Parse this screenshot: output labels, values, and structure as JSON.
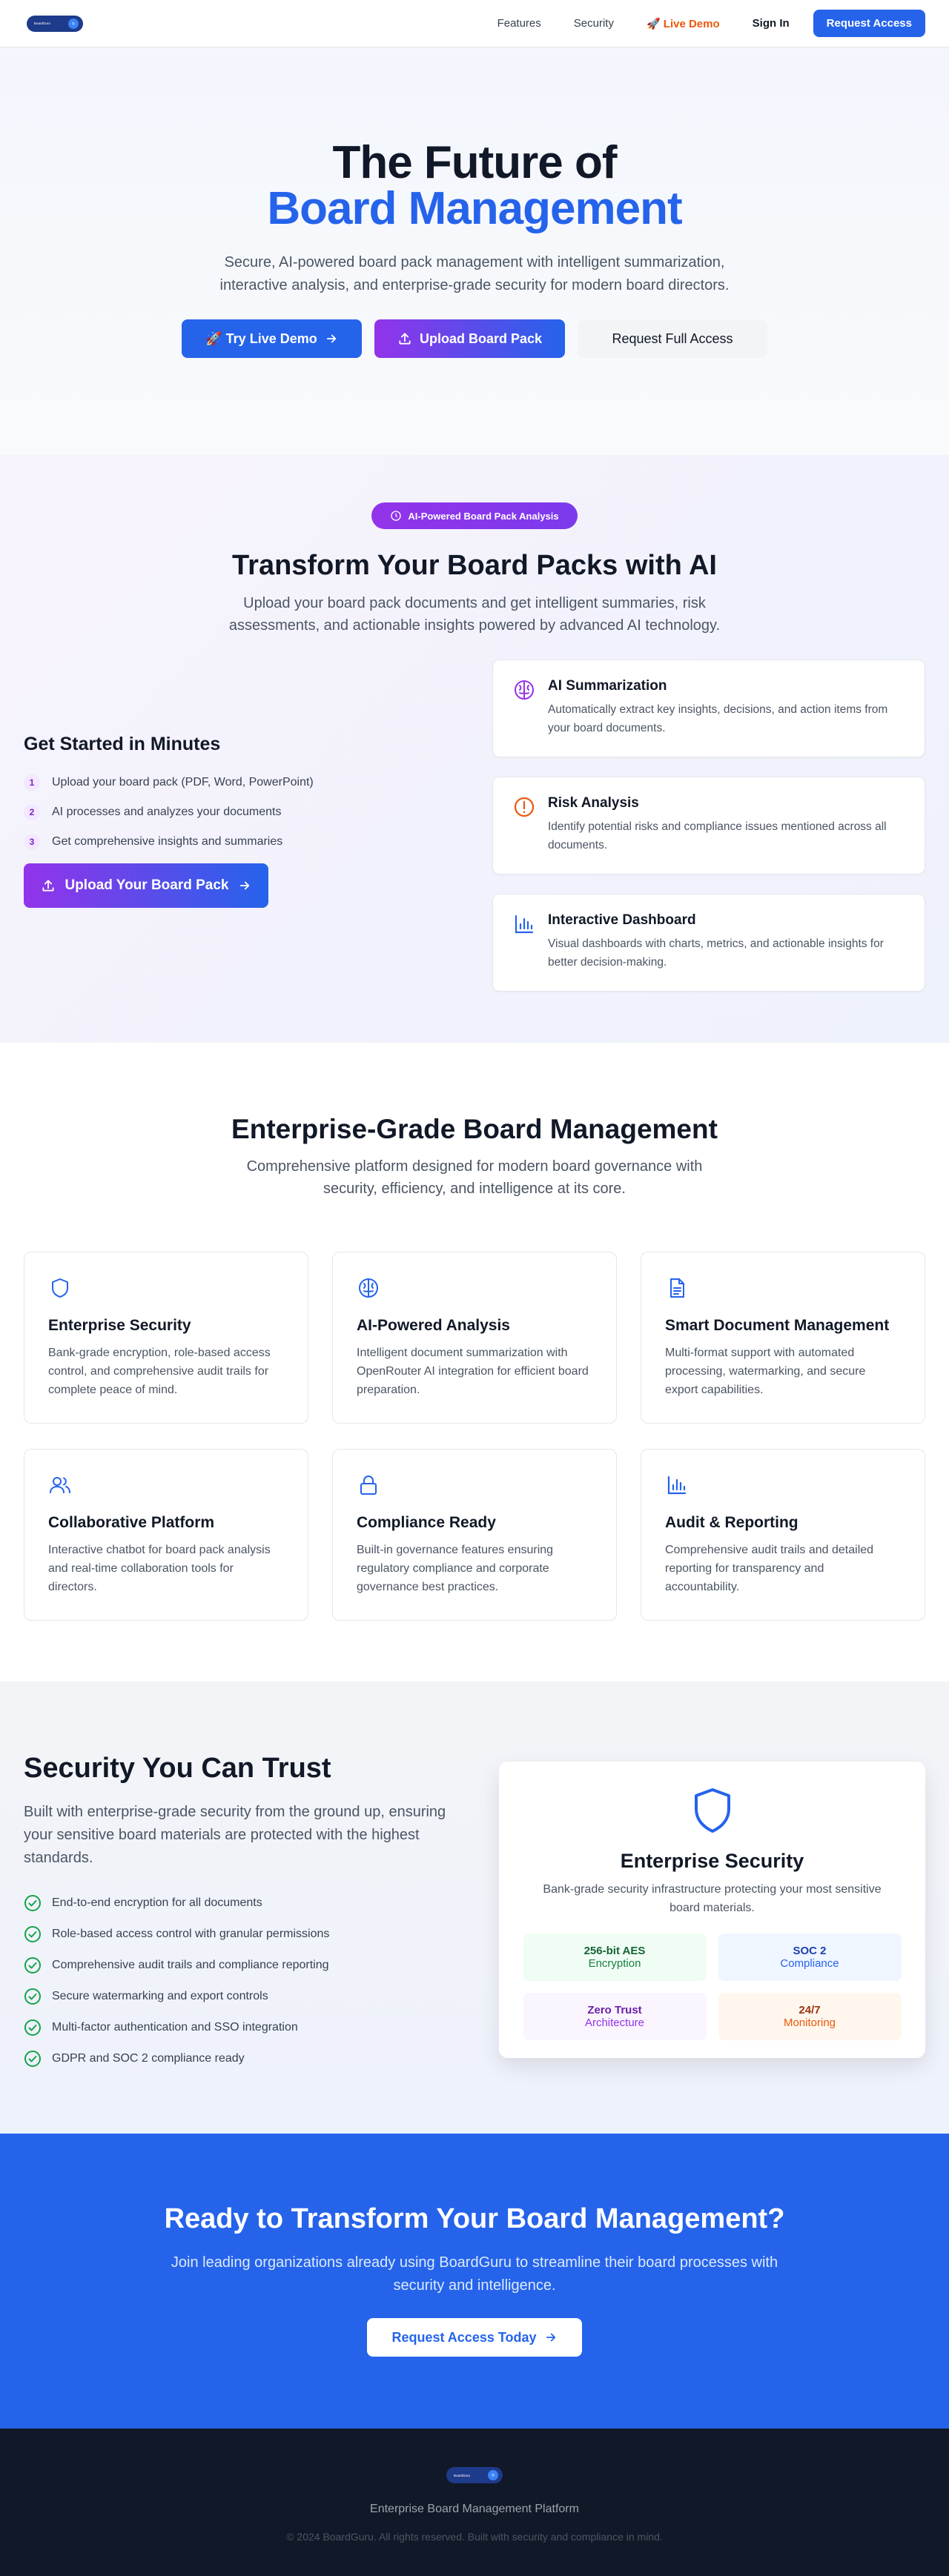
{
  "nav": {
    "logo_text": "BoardGuru",
    "links": [
      "Features",
      "Security"
    ],
    "demo_label": "🚀 Live Demo",
    "signin_label": "Sign In",
    "request_label": "Request Access"
  },
  "hero": {
    "title_line1": "The Future of",
    "title_line2": "Board Management",
    "subtitle": "Secure, AI-powered board pack management with intelligent summarization, interactive analysis, and enterprise-grade security for modern board directors.",
    "btn_demo": "🚀 Try Live Demo",
    "btn_upload": "Upload Board Pack",
    "btn_request": "Request Full Access"
  },
  "ai": {
    "badge": "AI-Powered Board Pack Analysis",
    "title": "Transform Your Board Packs with AI",
    "subtitle": "Upload your board pack documents and get intelligent summaries, risk assessments, and actionable insights powered by advanced AI technology.",
    "get_started": "Get Started in Minutes",
    "steps": [
      {
        "num": "1",
        "text": "Upload your board pack (PDF, Word, PowerPoint)"
      },
      {
        "num": "2",
        "text": "AI processes and analyzes your documents"
      },
      {
        "num": "3",
        "text": "Get comprehensive insights and summaries"
      }
    ],
    "upload_btn": "Upload Your Board Pack",
    "cards": [
      {
        "title": "AI Summarization",
        "text": "Automatically extract key insights, decisions, and action items from your board documents.",
        "icon": "brain-icon",
        "color": "#9333ea"
      },
      {
        "title": "Risk Analysis",
        "text": "Identify potential risks and compliance issues mentioned across all documents.",
        "icon": "alert-icon",
        "color": "#ea580c"
      },
      {
        "title": "Interactive Dashboard",
        "text": "Visual dashboards with charts, metrics, and actionable insights for better decision-making.",
        "icon": "chart-icon",
        "color": "#2563eb"
      }
    ]
  },
  "features": {
    "title": "Enterprise-Grade Board Management",
    "subtitle": "Comprehensive platform designed for modern board governance with security, efficiency, and intelligence at its core.",
    "items": [
      {
        "title": "Enterprise Security",
        "text": "Bank-grade encryption, role-based access control, and comprehensive audit trails for complete peace of mind.",
        "icon": "shield-icon"
      },
      {
        "title": "AI-Powered Analysis",
        "text": "Intelligent document summarization with OpenRouter AI integration for efficient board preparation.",
        "icon": "brain-icon"
      },
      {
        "title": "Smart Document Management",
        "text": "Multi-format support with automated processing, watermarking, and secure export capabilities.",
        "icon": "document-icon"
      },
      {
        "title": "Collaborative Platform",
        "text": "Interactive chatbot for board pack analysis and real-time collaboration tools for directors.",
        "icon": "users-icon"
      },
      {
        "title": "Compliance Ready",
        "text": "Built-in governance features ensuring regulatory compliance and corporate governance best practices.",
        "icon": "lock-icon"
      },
      {
        "title": "Audit & Reporting",
        "text": "Comprehensive audit trails and detailed reporting for transparency and accountability.",
        "icon": "chart-icon"
      }
    ]
  },
  "security": {
    "title": "Security You Can Trust",
    "subtitle": "Built with enterprise-grade security from the ground up, ensuring your sensitive board materials are protected with the highest standards.",
    "checks": [
      "End-to-end encryption for all documents",
      "Role-based access control with granular permissions",
      "Comprehensive audit trails and compliance reporting",
      "Secure watermarking and export controls",
      "Multi-factor authentication and SSO integration",
      "GDPR and SOC 2 compliance ready"
    ],
    "card_title": "Enterprise Security",
    "card_text": "Bank-grade security infrastructure protecting your most sensitive board materials.",
    "stats": [
      {
        "value": "256-bit AES",
        "label": "Encryption"
      },
      {
        "value": "SOC 2",
        "label": "Compliance"
      },
      {
        "value": "Zero Trust",
        "label": "Architecture"
      },
      {
        "value": "24/7",
        "label": "Monitoring"
      }
    ]
  },
  "cta": {
    "title": "Ready to Transform Your Board Management?",
    "text": "Join leading organizations already using BoardGuru to streamline their board processes with security and intelligence.",
    "button": "Request Access Today"
  },
  "footer": {
    "tagline": "Enterprise Board Management Platform",
    "copyright": "© 2024 BoardGuru. All rights reserved. Built with security and compliance in mind."
  }
}
